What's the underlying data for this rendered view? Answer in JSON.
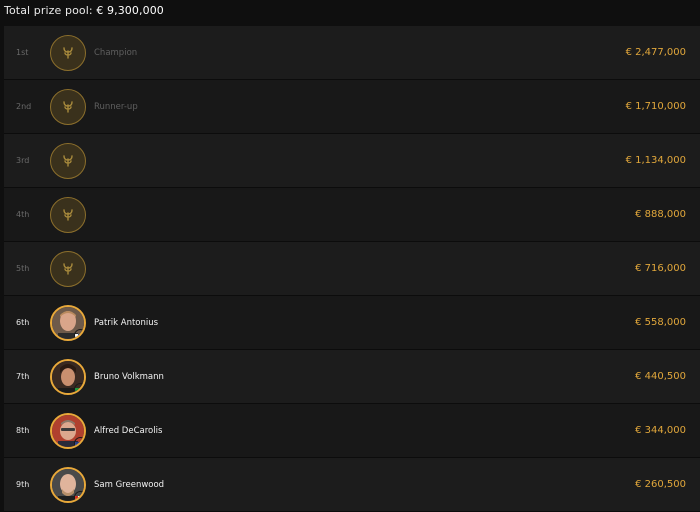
{
  "header": {
    "label": "Total prize pool:",
    "value": "€ 9,300,000"
  },
  "colors": {
    "accent": "#e1a73b",
    "placeholder_bg": "#3a311c",
    "placeholder_border": "#8c6f2c"
  },
  "payouts": [
    {
      "rank": "1st",
      "name": "Champion",
      "prize": "€ 2,477,000",
      "avatar": "laurel-icon"
    },
    {
      "rank": "2nd",
      "name": "Runner-up",
      "prize": "€ 1,710,000",
      "avatar": "laurel-icon"
    },
    {
      "rank": "3rd",
      "name": "",
      "prize": "€ 1,134,000",
      "avatar": "laurel-icon"
    },
    {
      "rank": "4th",
      "name": "",
      "prize": "€ 888,000",
      "avatar": "laurel-icon"
    },
    {
      "rank": "5th",
      "name": "",
      "prize": "€ 716,000",
      "avatar": "laurel-icon"
    },
    {
      "rank": "6th",
      "name": "Patrik Antonius",
      "prize": "€ 558,000",
      "avatar": "player-photo",
      "flag": "finland-flag-icon"
    },
    {
      "rank": "7th",
      "name": "Bruno Volkmann",
      "prize": "€ 440,500",
      "avatar": "player-photo",
      "flag": "brazil-flag-icon"
    },
    {
      "rank": "8th",
      "name": "Alfred DeCarolis",
      "prize": "€ 344,000",
      "avatar": "player-photo",
      "flag": "usa-flag-icon"
    },
    {
      "rank": "9th",
      "name": "Sam Greenwood",
      "prize": "€ 260,500",
      "avatar": "player-photo",
      "flag": "canada-flag-icon"
    }
  ]
}
